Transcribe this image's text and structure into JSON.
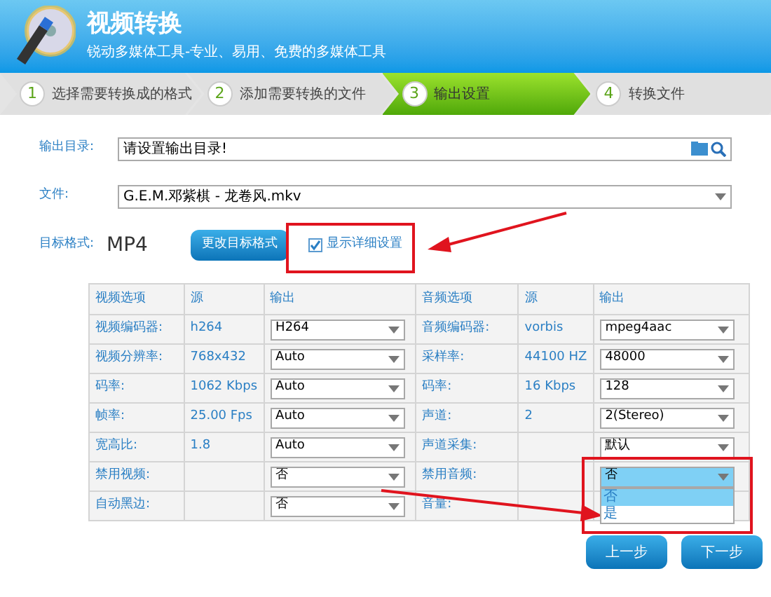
{
  "header": {
    "title": "视频转换",
    "subtitle": "锐动多媒体工具-专业、易用、免费的多媒体工具"
  },
  "steps": [
    {
      "number": "1",
      "label": "选择需要转换成的格式",
      "selected": false
    },
    {
      "number": "2",
      "label": "添加需要转换的文件",
      "selected": false
    },
    {
      "number": "3",
      "label": "输出设置",
      "selected": true
    },
    {
      "number": "4",
      "label": "转换文件",
      "selected": false
    }
  ],
  "form": {
    "output_dir": {
      "label": "输出目录:",
      "value": "请设置输出目录!"
    },
    "file": {
      "label": "文件:",
      "value": "G.E.M.邓紫棋 - 龙卷风.mkv"
    },
    "target": {
      "label": "目标格式:",
      "value": "MP4",
      "button": "更改目标格式",
      "checkbox": {
        "label": "显示详细设置",
        "checked": true
      }
    }
  },
  "video_table": {
    "columns": [
      "视频选项",
      "源",
      "输出"
    ],
    "rows": [
      {
        "label": "视频编码器:",
        "source": "h264",
        "output": "H264"
      },
      {
        "label": "视频分辨率:",
        "source": "768x432",
        "output": "Auto"
      },
      {
        "label": "码率:",
        "source": "1062 Kbps",
        "output": "Auto"
      },
      {
        "label": "帧率:",
        "source": "25.00 Fps",
        "output": "Auto"
      },
      {
        "label": "宽高比:",
        "source": "1.8",
        "output": "Auto"
      },
      {
        "label": "禁用视频:",
        "output": "否"
      },
      {
        "label": "自动黑边:",
        "output": "否"
      }
    ]
  },
  "audio_table": {
    "columns": [
      "音频选项",
      "源",
      "输出"
    ],
    "rows": [
      {
        "label": "音频编码器:",
        "source": "vorbis",
        "output": "mpeg4aac"
      },
      {
        "label": "采样率:",
        "source": "44100 HZ",
        "output": "48000"
      },
      {
        "label": "码率:",
        "source": "16 Kbps",
        "output": "128"
      },
      {
        "label": "声道:",
        "source": "2",
        "output": "2(Stereo)"
      },
      {
        "label": "声道采集:",
        "output": "默认"
      },
      {
        "label": "禁用音频:",
        "output": "否",
        "open": true,
        "options": [
          {
            "label": "否",
            "selected": true
          },
          {
            "label": "是",
            "selected": false
          }
        ]
      },
      {
        "label": "音量:"
      }
    ]
  },
  "buttons": [
    "上一步",
    "下一步"
  ]
}
